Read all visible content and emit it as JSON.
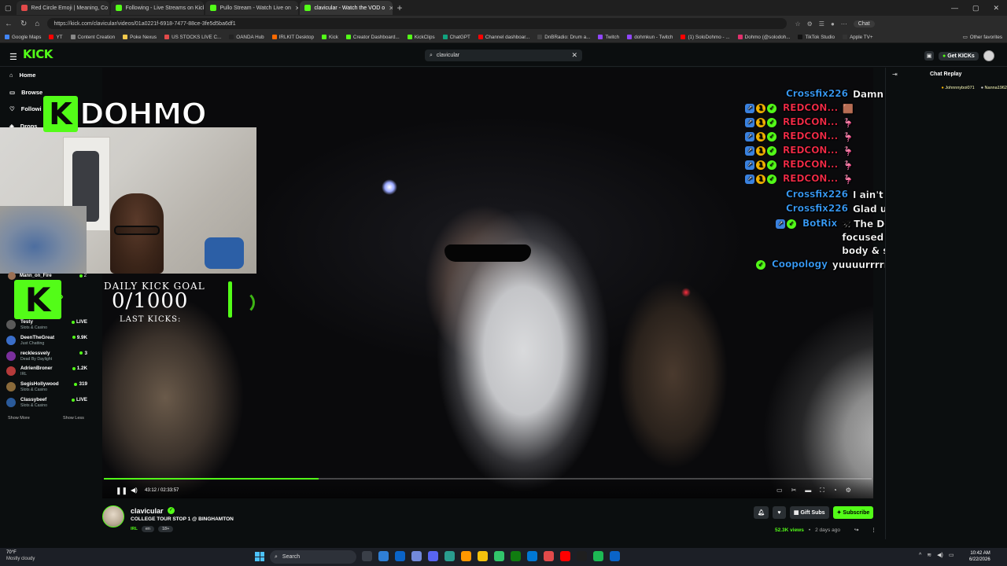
{
  "browser": {
    "tabs": [
      {
        "title": "Red Circle Emoji | Meaning, Co",
        "color": "#e24a4a",
        "active": false
      },
      {
        "title": "Following - Live Streams on Kick",
        "color": "#53fc18",
        "active": false
      },
      {
        "title": "Pullo Stream - Watch Live on",
        "color": "#53fc18",
        "active": false
      },
      {
        "title": "clavicular - Watch the VOD o",
        "color": "#53fc18",
        "active": true
      }
    ],
    "new_tab": "+",
    "url": "https://kick.com/clavicular/videos/01a0221f-6918-7477-88ce-3fe5d5ba6df1",
    "chat_pill": "Chat",
    "bookmarks": [
      {
        "label": "Google Maps",
        "color": "#4285f4"
      },
      {
        "label": "YT",
        "color": "#ff0000"
      },
      {
        "label": "Content Creation",
        "color": "#888888"
      },
      {
        "label": "Poke Nexus",
        "color": "#f2c94c"
      },
      {
        "label": "US STOCKS LIVE C...",
        "color": "#e24a4a"
      },
      {
        "label": "OANDA Hub",
        "color": "#222222"
      },
      {
        "label": "IRLKIT Desktop",
        "color": "#ff6a00"
      },
      {
        "label": "Kick",
        "color": "#53fc18"
      },
      {
        "label": "Creator Dashboard...",
        "color": "#53fc18"
      },
      {
        "label": "KickClips",
        "color": "#53fc18"
      },
      {
        "label": "ChatGPT",
        "color": "#10a37f"
      },
      {
        "label": "Channel dashboar...",
        "color": "#ff0000"
      },
      {
        "label": "DnBRadio: Drum a...",
        "color": "#444444"
      },
      {
        "label": "Twitch",
        "color": "#9146ff"
      },
      {
        "label": "dohmkun - Twitch",
        "color": "#9146ff"
      },
      {
        "label": "(1) SoloDohmo - ...",
        "color": "#ff0000"
      },
      {
        "label": "Dohmo (@solodoh...",
        "color": "#e1306c"
      },
      {
        "label": "TikTok Studio",
        "color": "#111111"
      },
      {
        "label": "Apple TV+",
        "color": "#333333"
      }
    ],
    "other_bookmarks": "Other favorites"
  },
  "kick": {
    "logo": "KICK",
    "search_value": "clavicular",
    "get_kicks": "Get KICKs",
    "nav": [
      {
        "label": "Home",
        "icon": "home-icon",
        "glyph": "⌂"
      },
      {
        "label": "Browse",
        "icon": "browse-icon",
        "glyph": "▭"
      },
      {
        "label": "Followi",
        "icon": "heart-icon",
        "glyph": "♡"
      },
      {
        "label": "Drops",
        "icon": "drops-icon",
        "glyph": "◈"
      }
    ],
    "channels": [
      {
        "name": "Testy",
        "category": "Slots & Casino",
        "viewers": "LIVE",
        "color": "#5a5a5a"
      },
      {
        "name": "DeenTheGreat",
        "category": "Just Chatting",
        "viewers": "9.9K",
        "color": "#3a6ec9"
      },
      {
        "name": "recklessvely",
        "category": "Dead By Daylight",
        "viewers": "3",
        "color": "#7a2f9c"
      },
      {
        "name": "AdrienBroner",
        "category": "IRL",
        "viewers": "1.2K",
        "color": "#b53a3a"
      },
      {
        "name": "SegisHollywood",
        "category": "Slots & Casino",
        "viewers": "319",
        "color": "#8a6a3a"
      },
      {
        "name": "Classybeef",
        "category": "Slots & Casino",
        "viewers": "LIVE",
        "color": "#2a5a9a"
      }
    ],
    "show_more": "Show More",
    "show_less": "Show Less"
  },
  "overlay": {
    "streamer_logo": "DOHMO",
    "k_glyph": "K",
    "mann_name": "Mann_on_Fire",
    "mann_viewers": "2",
    "goal_title": "DAILY KICK GOAL",
    "goal_count": "0/1000",
    "goal_progress": 0,
    "goal_last": "LAST KICKS:"
  },
  "chat_overlay": [
    {
      "user": "Crossfix226",
      "msg": "Damn bro ur leg right",
      "badges": [],
      "red": false
    },
    {
      "user": "REDCON...",
      "msg": "🟫",
      "badges": [
        "b1",
        "b2",
        "b3"
      ],
      "red": true
    },
    {
      "user": "REDCON...",
      "msg": "🦩",
      "badges": [
        "b1",
        "b2",
        "b3"
      ],
      "red": true
    },
    {
      "user": "REDCON...",
      "msg": "🦩",
      "badges": [
        "b1",
        "b2",
        "b3"
      ],
      "red": true
    },
    {
      "user": "REDCON...",
      "msg": "🦩",
      "badges": [
        "b1",
        "b2",
        "b3"
      ],
      "red": true
    },
    {
      "user": "REDCON...",
      "msg": "🦩",
      "badges": [
        "b1",
        "b2",
        "b3"
      ],
      "red": true
    },
    {
      "user": "REDCON...",
      "msg": "🦩",
      "badges": [
        "b1",
        "b2",
        "b3"
      ],
      "red": true
    },
    {
      "user": "Crossfix226",
      "msg": "I ain't got discord",
      "badges": [],
      "red": false
    },
    {
      "user": "Crossfix226",
      "msg": "Glad u good homie",
      "badges": [],
      "red": false
    },
    {
      "user": "BotRix",
      "msg": "🕉 The Dohjo encourages a focused balance of mind, body & spirit *bows* 🕉",
      "badges": [
        "b1",
        "b3"
      ],
      "red": false
    },
    {
      "user": "Coopology",
      "msg": "yuuuurrrrr",
      "badges": [
        "b3"
      ],
      "red": false
    }
  ],
  "chat_panel": {
    "title": "Chat Replay",
    "pinned_a": "Johnnnyboi071",
    "pinned_b": "Nanna1962"
  },
  "player": {
    "timecode": "43:12 / 02:33:57",
    "progress": 0.28
  },
  "channel": {
    "name": "clavicular",
    "title": "COLLEGE TOUR STOP 1 @ BINGHAMTON",
    "category": "IRL",
    "tags": [
      "en",
      "18+"
    ],
    "gift_subs": "Gift Subs",
    "subscribe": "Subscribe",
    "views": "52.3K views",
    "age": "2 days ago"
  },
  "taskbar": {
    "temp": "70°F",
    "condition": "Mostly cloudy",
    "search": "Search",
    "time": "10:42 AM",
    "date": "6/22/2026",
    "app_colors": [
      "#3a3f48",
      "#2f7fd6",
      "#0a64c8",
      "#7289da",
      "#5865f2",
      "#2a9d8f",
      "#ff9800",
      "#f4c20d",
      "#32c66b",
      "#107c10",
      "#0078d4",
      "#e24a4a",
      "#ff0000",
      "#1f1f1f",
      "#1db954",
      "#0a64c8"
    ]
  }
}
